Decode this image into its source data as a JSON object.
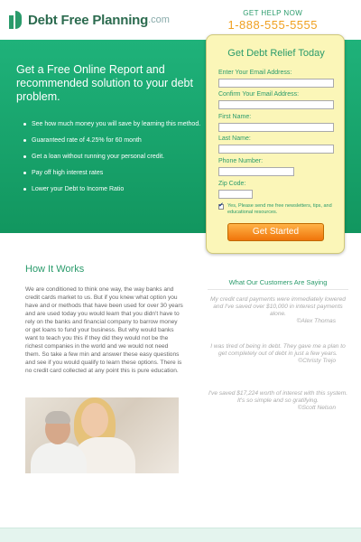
{
  "header": {
    "logo_text": "Debt Free Planning",
    "logo_suffix": ".com",
    "help_label": "GET HELP NOW",
    "phone": "1-888-555-5555"
  },
  "hero": {
    "title": "Get a Free Online Report and recommended solution to your debt problem.",
    "benefits": [
      "See how much money you will save by learning this method.",
      "Guaranteed rate of 4.25% for 60 month",
      "Get a loan without running your personal credit.",
      "Pay off high interest rates",
      "Lower your Debt to Income Ratio"
    ]
  },
  "form": {
    "title": "Get Debt Relief Today",
    "fields": [
      {
        "label": "Enter Your Email Address:",
        "value": "",
        "placeholder": ""
      },
      {
        "label": "Confirm Your Email Address:",
        "value": "",
        "placeholder": ""
      },
      {
        "label": "First Name:",
        "value": "",
        "placeholder": ""
      },
      {
        "label": "Last Name:",
        "value": "",
        "placeholder": ""
      },
      {
        "label": "Phone Number:",
        "value": "",
        "placeholder": ""
      },
      {
        "label": "Zip Code:",
        "value": "",
        "placeholder": ""
      }
    ],
    "consent_checked": true,
    "consent_text": "Yes, Please send me free newsletters, tips, and educational resources.",
    "submit_label": "Get Started"
  },
  "how": {
    "title": "How It Works",
    "text": "We are conditioned to think one way, the way banks and credit cards market to us. But if you knew what option you have and or methods that have been used for over 30 years and are used today you would learn that you didn't have to rely on the banks and financial company to barrow money or get loans to fund your business. But why would banks want to teach you this if they did they would not be the richest companies in the world and we would not need them. So take a few min and answer these easy questions and see if you would qualify to learn these options. There is no credit card collected at any point this is pure education."
  },
  "testimonials": {
    "title": "What Our Customers Are Saying",
    "items": [
      {
        "quote": "My credit card payments were immediately lowered and I've saved over $10,000 in interest payments alone.",
        "author": "©Alex Thomas"
      },
      {
        "quote": "I was tired of being in debt. They gave me a plan to get completely out of debt in just a few years.",
        "author": "©Christy Trejo"
      },
      {
        "quote": "I've saved $17,224 worth of interest with this system. It's so simple and so gratifying.",
        "author": "©Scott Nelson"
      }
    ]
  },
  "colors": {
    "brand_green": "#2a9b6b",
    "hero_green": "#1fb27a",
    "phone_orange": "#f0a020",
    "form_yellow": "#fbf6b8",
    "button_orange": "#f0740a"
  },
  "icons": {
    "logo": "debt-free-logo-icon",
    "checkbox": "checkmark-icon"
  }
}
